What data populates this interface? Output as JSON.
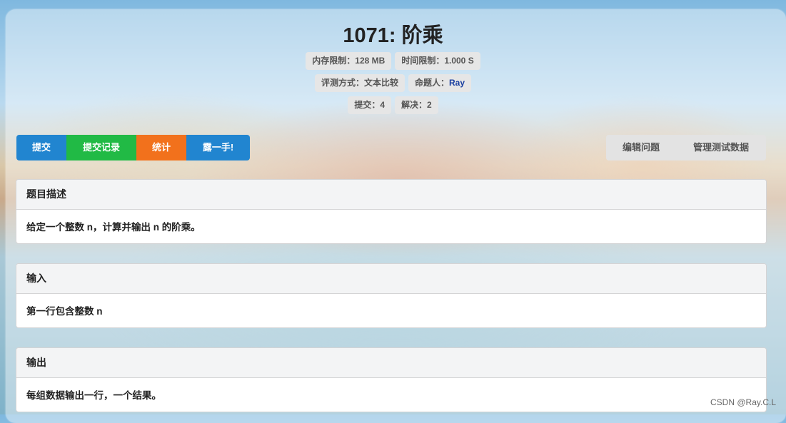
{
  "problem": {
    "title": "1071: 阶乘",
    "memory_limit": "内存限制：128 MB",
    "time_limit": "时间限制：1.000 S",
    "judge_method": "评测方式：文本比较",
    "setter_label": "命题人：",
    "setter_name": "Ray",
    "submissions": "提交：4",
    "solved": "解决：2"
  },
  "actions": {
    "submit": "提交",
    "submit_records": "提交记录",
    "statistics": "统计",
    "show_off": "露一手!",
    "edit_problem": "编辑问题",
    "manage_testdata": "管理测试数据"
  },
  "sections": {
    "description": {
      "title": "题目描述",
      "body": "给定一个整数 n，计算并输出 n 的阶乘。"
    },
    "input": {
      "title": "输入",
      "body": "第一行包含整数 n"
    },
    "output": {
      "title": "输出",
      "body": "每组数据输出一行，一个结果。"
    }
  },
  "watermark": "CSDN @Ray.C.L"
}
